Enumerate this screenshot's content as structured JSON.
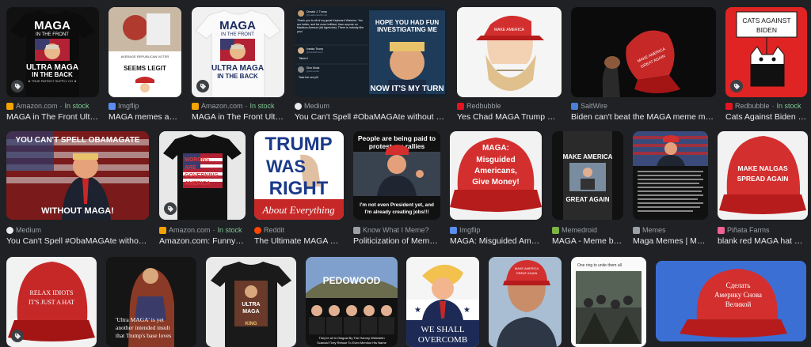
{
  "results": [
    {
      "source": "Amazon.com",
      "stock": "In stock",
      "title": "MAGA in The Front Ultra ...",
      "favicon_color": "#f4a300",
      "image_text": [
        "MAGA",
        "IN THE FRONT",
        "ULTRA MAGA",
        "IN THE BACK",
        "★ TRUE PATRIOT SUPPLY CO ★"
      ]
    },
    {
      "source": "Imgflip",
      "title": "MAGA memes abo...",
      "favicon_color": "#5b8def",
      "image_text": [
        "AVERAGE REPUBLICAN VOTER",
        "SEEMS LEGIT"
      ]
    },
    {
      "source": "Amazon.com",
      "stock": "In stock",
      "title": "MAGA in The Front Ultra ...",
      "favicon_color": "#f4a300",
      "image_text": [
        "MAGA",
        "IN THE FRONT",
        "ULTRA MAGA",
        "IN THE BACK"
      ]
    },
    {
      "source": "Medium",
      "title": "You Can't Spell #ObaMAGAte without MAGA ...",
      "favicon_color": "#e8eaed",
      "image_text": [
        "Donald J. Trump",
        "@realDonaldTrump",
        "Thank you to all of my great Keyboard Warriors. You are better, and far more brilliant, than anyone on Madison Avenue (Ad Agencies). There is nobody like you!",
        "Ivanka Trump",
        "@IvankaTrump",
        "Taken!",
        "Elon Musk",
        "@elonmusk",
        "Take the red pill",
        "HOPE YOU HAD FUN",
        "INVESTIGATING ME",
        "NOW IT'S MY TURN"
      ]
    },
    {
      "source": "Redbubble",
      "title": "Yes Chad MAGA Trump Hat ...",
      "favicon_color": "#e41321",
      "image_text": []
    },
    {
      "source": "SaltWire",
      "title": "Biden can't beat the MAGA meme machin...",
      "favicon_color": "#4a7fd6",
      "image_text": [
        "MAKE AMERICA",
        "GREAT AGAIN"
      ]
    },
    {
      "source": "Redbubble",
      "stock": "In stock",
      "title": "Cats Against Biden Pro...",
      "favicon_color": "#e41321",
      "image_text": [
        "CATS AGAINST",
        "BIDEN"
      ]
    },
    {
      "source": "Medium",
      "title": "You Can't Spell #ObaMAGAte without MA...",
      "favicon_color": "#e8eaed",
      "image_text": [
        "YOU CAN'T SPELL OBAMAGATE",
        "WITHOUT MAGA!"
      ]
    },
    {
      "source": "Amazon.com",
      "stock": "In stock",
      "title": "Amazon.com: Funny M...",
      "favicon_color": "#f4a300",
      "image_text": [
        "MORONS",
        "ARE",
        "GOVERNING",
        "AMERICA"
      ]
    },
    {
      "source": "Reddit",
      "title": "The Ultimate MAGA Me...",
      "favicon_color": "#ff4500",
      "image_text": [
        "TRUMP",
        "WAS",
        "RIGHT",
        "About Everything"
      ]
    },
    {
      "source": "Know What I Meme?",
      "title": "Politicization of Memes...",
      "favicon_color": "#9aa0a6",
      "image_text": [
        "People are being paid to",
        "protest my rallies",
        "I'm not even President yet, and",
        "I'm already creating jobs!!!"
      ]
    },
    {
      "source": "Imgflip",
      "title": "MAGA: Misguided Ameri...",
      "favicon_color": "#5b8def",
      "image_text": [
        "MAGA:",
        "Misguided",
        "Americans,",
        "Give Money!"
      ]
    },
    {
      "source": "Memedroid",
      "title": "MAGA - Meme by a...",
      "favicon_color": "#7cb342",
      "image_text": [
        "MAKE AMERICA",
        "GREAT AGAIN"
      ]
    },
    {
      "source": "Memes",
      "title": "Maga Memes | Me...",
      "favicon_color": "#9aa0a6",
      "image_text": []
    },
    {
      "source": "Piñata Farms",
      "title": "blank red MAGA hat Me...",
      "favicon_color": "#f06292",
      "image_text": [
        "MAKE NALGAS",
        "SPREAD AGAIN"
      ]
    },
    {
      "image_text": [
        "RELAX IDIOTS",
        "IT'S JUST A HAT"
      ]
    },
    {
      "image_text": [
        "'Ultra MAGA' is yet",
        "another intended insult",
        "that Trump's base loves"
      ]
    },
    {
      "image_text": [
        "ULTRA",
        "MAGA",
        "KING"
      ]
    },
    {
      "image_text": [
        "PEDOWOOD",
        "They're all In Disgust By The Harvey Weinstein",
        "Scandal They Refuse To Even Mention His Name"
      ]
    },
    {
      "image_text": [
        "WE SHALL",
        "OVERCOMB"
      ]
    },
    {
      "image_text": [
        "MAKE AMERICA",
        "GREAT AGAIN"
      ]
    },
    {
      "image_text": [
        "One ring to unite them all"
      ]
    },
    {
      "image_text": [
        "Сделать",
        "Америку Снова",
        "Великой"
      ]
    }
  ],
  "icons": {
    "shopping_badge": "shopping-tag-icon"
  }
}
